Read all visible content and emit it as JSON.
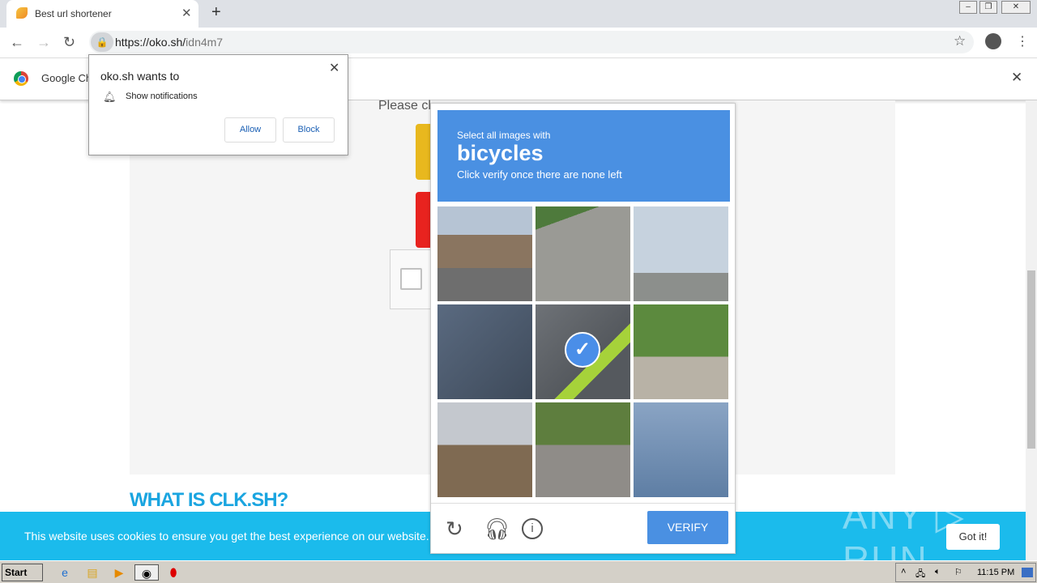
{
  "browser": {
    "tab_title": "Best url shortener",
    "url_host": "https://oko.sh/",
    "url_path": "idn4m7",
    "infobar_text": "Google Ch"
  },
  "notification": {
    "title": "oko.sh wants to",
    "permission": "Show notifications",
    "allow": "Allow",
    "block": "Block"
  },
  "page": {
    "please_text": "Please cl",
    "heading": "WHAT IS CLK.SH?",
    "cookie_text": "This website uses cookies to ensure you get the best experience on our website. Le",
    "got_it": "Got it!",
    "watermark": "ANY RUN"
  },
  "captcha": {
    "line1": "Select all images with",
    "keyword": "bicycles",
    "line2": "Click verify once there are none left",
    "verify": "VERIFY",
    "selected_tile": 4,
    "tiles": [
      "street-storefronts",
      "road-car",
      "traffic-light",
      "bicycle-wheel",
      "cyclist",
      "bus-street",
      "street-corner",
      "tree-lined-street",
      "bridge-overpass"
    ]
  },
  "colors": {
    "captcha_blue": "#4a90e2",
    "cookie_bar": "#1bbbec",
    "heading": "#1aa5e0"
  },
  "taskbar": {
    "start": "Start",
    "clock": "11:15 PM"
  }
}
